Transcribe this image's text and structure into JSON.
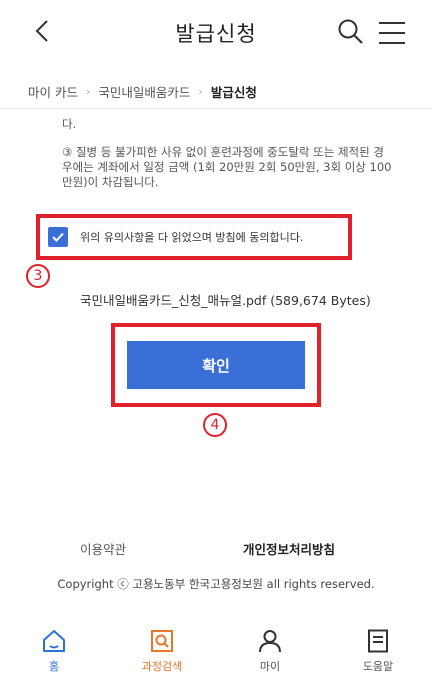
{
  "header": {
    "title": "발급신청"
  },
  "breadcrumb": {
    "items": [
      "마이 카드",
      "국민내일배움카드",
      "발급신청"
    ],
    "separator": "›"
  },
  "notice": {
    "tail_text": "다.",
    "item3": "③ 질병 등 불가피한 사유 없이 훈련과정에 중도탈락 또는 제적된 경우에는 계좌에서 일정 금액 (1회 20만원 2회 50만원, 3회 이상 100만원)이 차감됩니다."
  },
  "agreement": {
    "checked": true,
    "label": "위의 유의사항을 다 읽었으며 방침에 동의합니다."
  },
  "markers": {
    "step3": "3",
    "step4": "4"
  },
  "attachment": {
    "text": "국민내일배움카드_신청_매뉴얼.pdf (589,674 Bytes)"
  },
  "confirm_label": "확인",
  "footer": {
    "terms": "이용약관",
    "privacy": "개인정보처리방침",
    "copyright": "Copyright ⓒ 고용노동부 한국고용정보원 all rights reserved."
  },
  "bottom_nav": {
    "home": "홈",
    "course_search": "과정검색",
    "my": "마이",
    "help": "도움말"
  },
  "colors": {
    "accent_blue": "#3a6fd8",
    "highlight_red": "#e0202a",
    "active_orange": "#e8762b"
  }
}
